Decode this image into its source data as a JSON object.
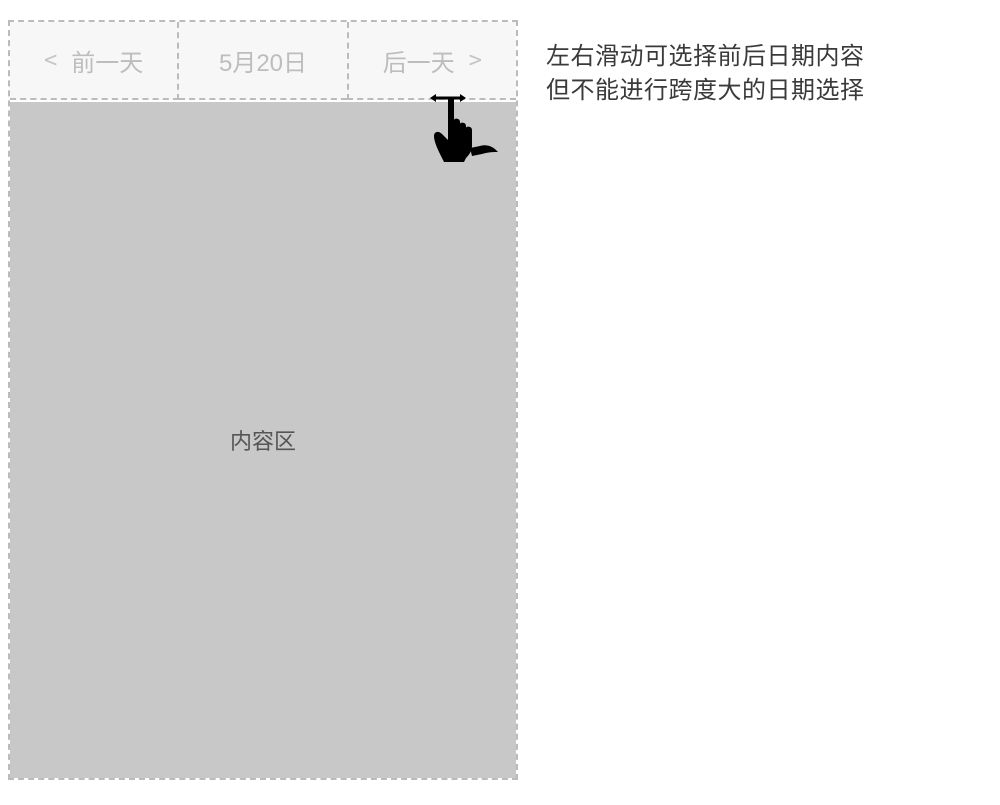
{
  "dateNav": {
    "prev": {
      "label": "前一天",
      "chevron": "<"
    },
    "current": {
      "label": "5月20日"
    },
    "next": {
      "label": "后一天",
      "chevron": ">"
    }
  },
  "contentArea": {
    "label": "内容区"
  },
  "annotation": {
    "line1": "左右滑动可选择前后日期内容",
    "line2": "但不能进行跨度大的日期选择"
  }
}
